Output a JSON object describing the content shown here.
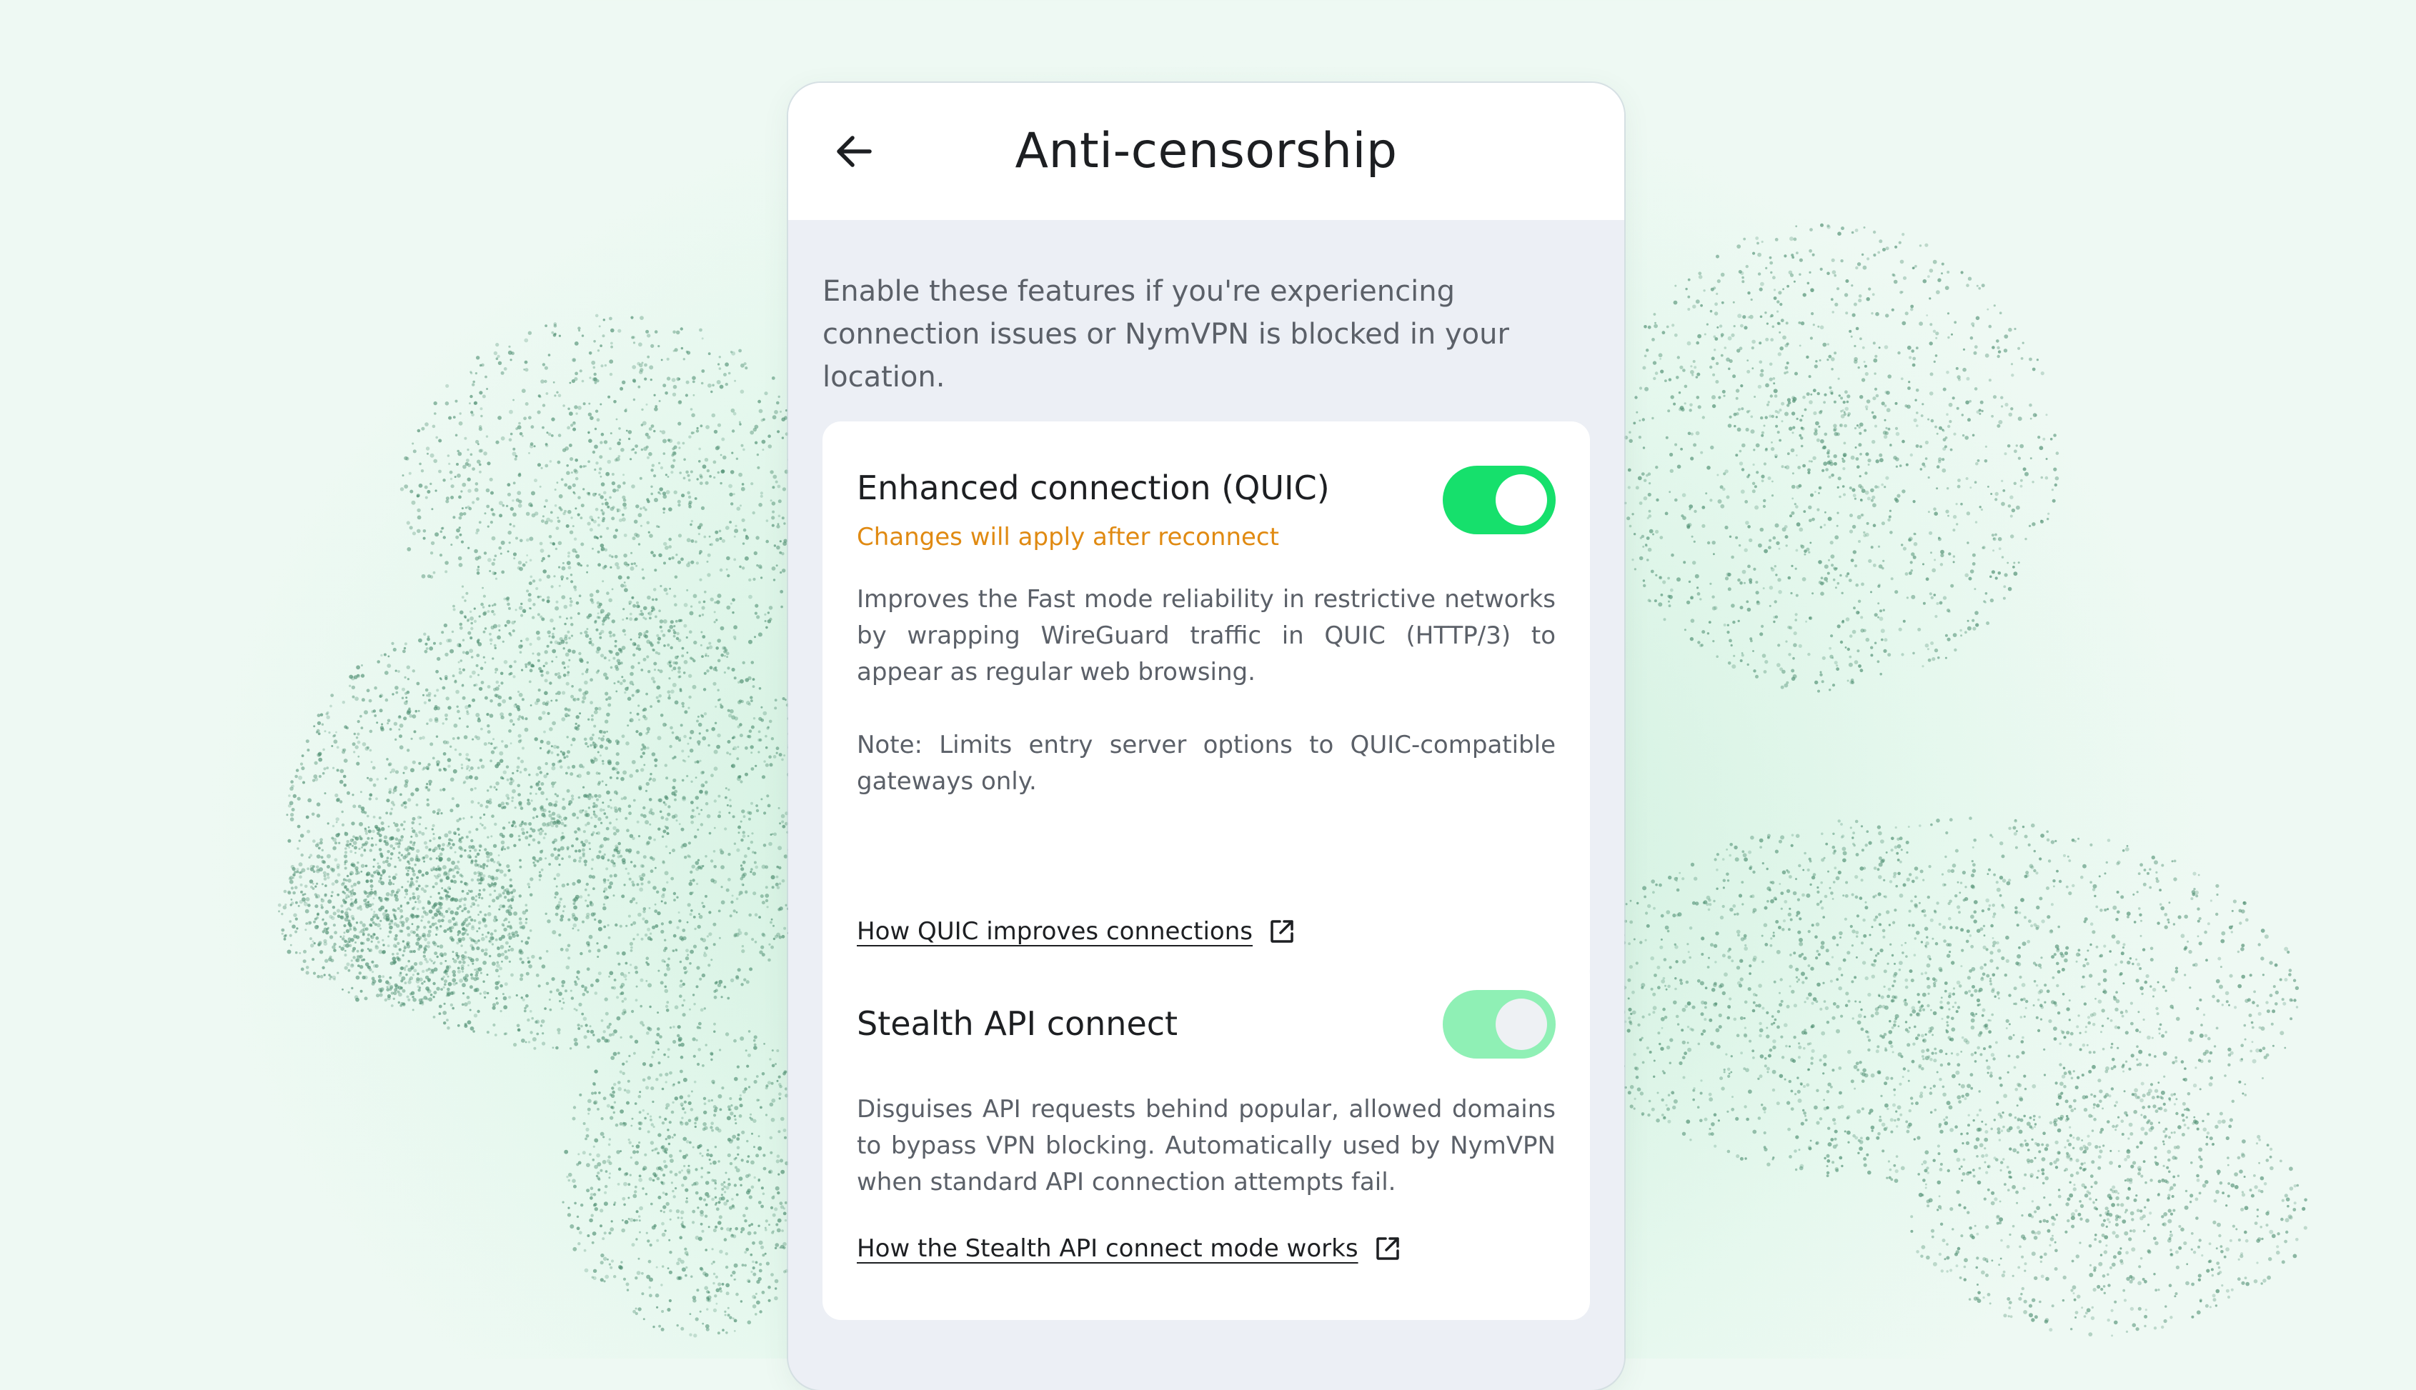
{
  "header": {
    "title": "Anti-censorship",
    "back_icon": "arrow-left-icon"
  },
  "intro": "Enable these features if you're experiencing connection issues or NymVPN is blocked in your location.",
  "cards": [
    {
      "title": "Enhanced connection (QUIC)",
      "warning": "Changes will apply after reconnect",
      "description": "Improves the Fast mode reliability in restrictive networks by wrapping WireGuard traffic in QUIC (HTTP/3) to appear as regular web browsing.",
      "note": "Note: Limits entry server options to QUIC-compatible gateways only.",
      "link": "How QUIC improves connections",
      "link_icon": "external-link-icon",
      "toggle": {
        "on": true,
        "color": "#16e06c"
      }
    },
    {
      "title": "Stealth API connect",
      "description": "Disguises API requests behind popular, allowed domains to bypass VPN blocking. Automatically used by NymVPN when standard API connection attempts fail.",
      "link": "How the Stealth API connect mode works",
      "link_icon": "external-link-icon",
      "toggle": {
        "on": true,
        "disabled": true,
        "color": "#8ff0b5"
      }
    }
  ],
  "colors": {
    "accent_green": "#16e06c",
    "warning_orange": "#e08a12",
    "background_mint": "#d8f3e4"
  }
}
